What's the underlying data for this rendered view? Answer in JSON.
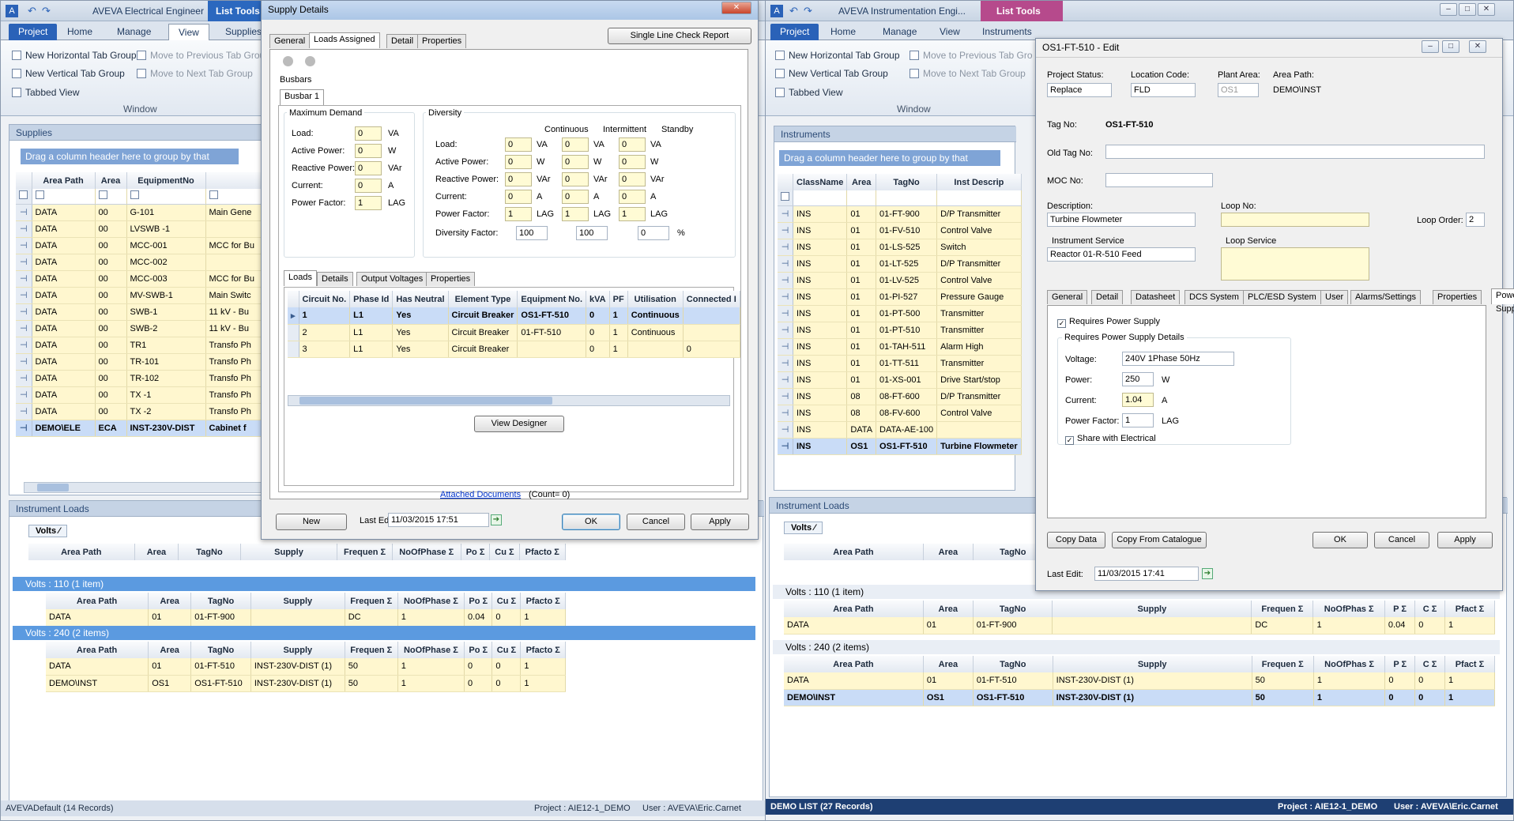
{
  "left_app": {
    "title": "AVEVA Electrical Engineer",
    "context_tab": "List Tools",
    "tabs": [
      "Project",
      "Home",
      "Manage",
      "View",
      "Supplies"
    ],
    "ribbon": {
      "col1": [
        "New Horizontal Tab Group",
        "New Vertical Tab Group",
        "Tabbed View"
      ],
      "col2": [
        "Move to Previous Tab Group",
        "Move to Next Tab Group"
      ],
      "group": "Window"
    },
    "supplies_panel": {
      "title": "Supplies",
      "drag_hint": "Drag a column header here to group by that column.",
      "columns": [
        "Area Path",
        "Area",
        "EquipmentNo",
        ""
      ],
      "rows": [
        [
          "DATA",
          "00",
          "G-101",
          "Main Gene"
        ],
        [
          "DATA",
          "00",
          "LVSWB -1",
          ""
        ],
        [
          "DATA",
          "00",
          "MCC-001",
          "MCC for Bu"
        ],
        [
          "DATA",
          "00",
          "MCC-002",
          ""
        ],
        [
          "DATA",
          "00",
          "MCC-003",
          "MCC for Bu"
        ],
        [
          "DATA",
          "00",
          "MV-SWB-1",
          "Main Switc"
        ],
        [
          "DATA",
          "00",
          "SWB-1",
          "11 kV - Bu"
        ],
        [
          "DATA",
          "00",
          "SWB-2",
          "11 kV - Bu"
        ],
        [
          "DATA",
          "00",
          "TR1",
          "Transfo Ph"
        ],
        [
          "DATA",
          "00",
          "TR-101",
          "Transfo Ph"
        ],
        [
          "DATA",
          "00",
          "TR-102",
          "Transfo Ph"
        ],
        [
          "DATA",
          "00",
          "TX -1",
          "Transfo Ph"
        ],
        [
          "DATA",
          "00",
          "TX -2",
          "Transfo Ph"
        ],
        [
          "DEMO\\ELE",
          "ECA",
          "INST-230V-DIST",
          "Cabinet f"
        ]
      ]
    },
    "loads_panel": {
      "title": "Instrument Loads",
      "chip": "Volts",
      "columns": [
        "Area Path",
        "Area",
        "TagNo",
        "Supply",
        "Frequen Σ",
        "NoOfPhase Σ",
        "Po Σ",
        "Cu Σ",
        "Pfacto Σ"
      ],
      "group1": "Volts : 110 (1 item)",
      "group1_rows": [
        [
          "DATA",
          "01",
          "01-FT-900",
          "",
          "DC",
          "1",
          "0.04",
          "0",
          "1"
        ]
      ],
      "group2": "Volts : 240 (2 items)",
      "group2_rows": [
        [
          "DATA",
          "01",
          "01-FT-510",
          "INST-230V-DIST (1)",
          "50",
          "1",
          "0",
          "0",
          "1"
        ],
        [
          "DEMO\\INST",
          "OS1",
          "OS1-FT-510",
          "INST-230V-DIST (1)",
          "50",
          "1",
          "0",
          "0",
          "1"
        ]
      ]
    },
    "status": {
      "left": "AVEVADefault (14 Records)",
      "project": "Project : AIE12-1_DEMO",
      "user": "User : AVEVA\\Eric.Carnet"
    }
  },
  "supply_dialog": {
    "title": "Supply Details",
    "close": "✕",
    "tabs": [
      "General",
      "Loads Assigned",
      "Detail",
      "Properties"
    ],
    "single_line_btn": "Single Line Check Report",
    "busbars_label": "Busbars",
    "busbar_tab": "Busbar 1",
    "max_demand": {
      "title": "Maximum Demand",
      "rows": [
        [
          "Load:",
          "0",
          "VA"
        ],
        [
          "Active Power:",
          "0",
          "W"
        ],
        [
          "Reactive Power:",
          "0",
          "VAr"
        ],
        [
          "Current:",
          "0",
          "A"
        ],
        [
          "Power Factor:",
          "1",
          "LAG"
        ]
      ]
    },
    "diversity": {
      "title": "Diversity",
      "headers": [
        "Continuous",
        "Intermittent",
        "Standby"
      ],
      "rows": [
        [
          "Load:",
          "0",
          "VA",
          "0",
          "VA",
          "0",
          "VA"
        ],
        [
          "Active Power:",
          "0",
          "W",
          "0",
          "W",
          "0",
          "W"
        ],
        [
          "Reactive Power:",
          "0",
          "VAr",
          "0",
          "VAr",
          "0",
          "VAr"
        ],
        [
          "Current:",
          "0",
          "A",
          "0",
          "A",
          "0",
          "A"
        ],
        [
          "Power Factor:",
          "1",
          "LAG",
          "1",
          "LAG",
          "1",
          "LAG"
        ]
      ],
      "factor_label": "Diversity Factor:",
      "factors": [
        "100",
        "100",
        "0"
      ],
      "factor_unit": "%"
    },
    "sub_tabs": [
      "Loads",
      "Details",
      "Output Voltages",
      "Properties"
    ],
    "loads_columns": [
      "Circuit No.",
      "Phase Id",
      "Has Neutral",
      "Element Type",
      "Equipment No.",
      "kVA",
      "PF",
      "Utilisation",
      "Connected I"
    ],
    "loads_rows": [
      [
        "1",
        "L1",
        "Yes",
        "Circuit Breaker",
        "OS1-FT-510",
        "0",
        "1",
        "Continuous",
        ""
      ],
      [
        "2",
        "L1",
        "Yes",
        "Circuit Breaker",
        "01-FT-510",
        "0",
        "1",
        "Continuous",
        ""
      ],
      [
        "3",
        "L1",
        "Yes",
        "Circuit Breaker",
        "",
        "0",
        "1",
        "",
        "0"
      ]
    ],
    "view_designer": "View Designer",
    "attached": "Attached Documents",
    "count": "(Count= 0)",
    "new": "New",
    "last_edit_label": "Last Edit:",
    "last_edit": "11/03/2015 17:51",
    "ok": "OK",
    "cancel": "Cancel",
    "apply": "Apply"
  },
  "right_app": {
    "title": "AVEVA Instrumentation Engi...",
    "context_tab": "List Tools",
    "tabs": [
      "Project",
      "Home",
      "Manage",
      "View",
      "Instruments"
    ],
    "ribbon": {
      "col1": [
        "New Horizontal Tab Group",
        "New Vertical Tab Group",
        "Tabbed View"
      ],
      "col2": [
        "Move to Previous Tab Gro",
        "Move to Next Tab Group"
      ],
      "group": "Window"
    },
    "instr_panel": {
      "title": "Instruments",
      "drag_hint": "Drag a column header here to group by that column.",
      "columns": [
        "ClassName",
        "Area",
        "TagNo",
        "Inst Descrip"
      ],
      "rows": [
        [
          "INS",
          "01",
          "01-FT-900",
          "D/P Transmitter"
        ],
        [
          "INS",
          "01",
          "01-FV-510",
          "Control Valve"
        ],
        [
          "INS",
          "01",
          "01-LS-525",
          "Switch"
        ],
        [
          "INS",
          "01",
          "01-LT-525",
          "D/P Transmitter"
        ],
        [
          "INS",
          "01",
          "01-LV-525",
          "Control Valve"
        ],
        [
          "INS",
          "01",
          "01-PI-527",
          "Pressure Gauge"
        ],
        [
          "INS",
          "01",
          "01-PT-500",
          "Transmitter"
        ],
        [
          "INS",
          "01",
          "01-PT-510",
          "Transmitter"
        ],
        [
          "INS",
          "01",
          "01-TAH-511",
          "Alarm High"
        ],
        [
          "INS",
          "01",
          "01-TT-511",
          "Transmitter"
        ],
        [
          "INS",
          "01",
          "01-XS-001",
          "Drive Start/stop"
        ],
        [
          "INS",
          "08",
          "08-FT-600",
          "D/P Transmitter"
        ],
        [
          "INS",
          "08",
          "08-FV-600",
          "Control Valve"
        ],
        [
          "INS",
          "DATA",
          "DATA-AE-100",
          ""
        ],
        [
          "INS",
          "OS1",
          "OS1-FT-510",
          "Turbine Flowmeter"
        ]
      ]
    },
    "loads_panel": {
      "title": "Instrument Loads",
      "chip": "Volts",
      "columns": [
        "Area Path",
        "Area",
        "TagNo",
        "Supply",
        "Frequen Σ",
        "NoOfPhas Σ",
        "P Σ",
        "C Σ",
        "Pfact Σ"
      ],
      "group1": "Volts : 110 (1 item)",
      "group1_rows": [
        [
          "DATA",
          "01",
          "01-FT-900",
          "",
          "DC",
          "1",
          "0.04",
          "0",
          "1"
        ]
      ],
      "group2": "Volts : 240 (2 items)",
      "group2_rows": [
        [
          "DATA",
          "01",
          "01-FT-510",
          "INST-230V-DIST (1)",
          "50",
          "1",
          "0",
          "0",
          "1"
        ],
        [
          "DEMO\\INST",
          "OS1",
          "OS1-FT-510",
          "INST-230V-DIST (1)",
          "50",
          "1",
          "0",
          "0",
          "1"
        ]
      ]
    },
    "status": {
      "left": "DEMO LIST (27 Records)",
      "project": "Project : AIE12-1_DEMO",
      "user": "User : AVEVA\\Eric.Carnet"
    }
  },
  "edit_dialog": {
    "title": "OS1-FT-510 - Edit",
    "project_status_label": "Project Status:",
    "project_status": "Replace",
    "location_label": "Location Code:",
    "location": "FLD",
    "plant_label": "Plant Area:",
    "plant": "OS1",
    "area_path_label": "Area Path:",
    "area_path": "DEMO\\INST",
    "tag_label": "Tag No:",
    "tag": "OS1-FT-510",
    "old_tag_label": "Old Tag No:",
    "moc_label": "MOC No:",
    "desc_label": "Description:",
    "desc": "Turbine Flowmeter",
    "loop_label": "Loop No:",
    "loop_order_label": "Loop Order:",
    "loop_order": "2",
    "inst_service_label": "Instrument Service",
    "inst_service": "Reactor 01-R-510 Feed",
    "loop_service_label": "Loop Service",
    "tabs": [
      "General",
      "Detail",
      "Datasheet",
      "DCS System",
      "PLC/ESD System",
      "User",
      "Alarms/Settings",
      "Properties",
      "Power Supply"
    ],
    "requires_ps": "Requires Power Supply",
    "details_label": "Requires Power Supply Details",
    "voltage_label": "Voltage:",
    "voltage": "240V  1Phase  50Hz",
    "power_label": "Power:",
    "power": "250",
    "power_unit": "W",
    "current_label": "Current:",
    "current": "1.04",
    "current_unit": "A",
    "pf_label": "Power Factor:",
    "pf": "1",
    "pf_unit": "LAG",
    "share": "Share with Electrical",
    "copy_data": "Copy Data",
    "copy_catalogue": "Copy From Catalogue",
    "ok": "OK",
    "cancel": "Cancel",
    "apply": "Apply",
    "last_edit_label": "Last Edit:",
    "last_edit": "11/03/2015 17:41"
  }
}
